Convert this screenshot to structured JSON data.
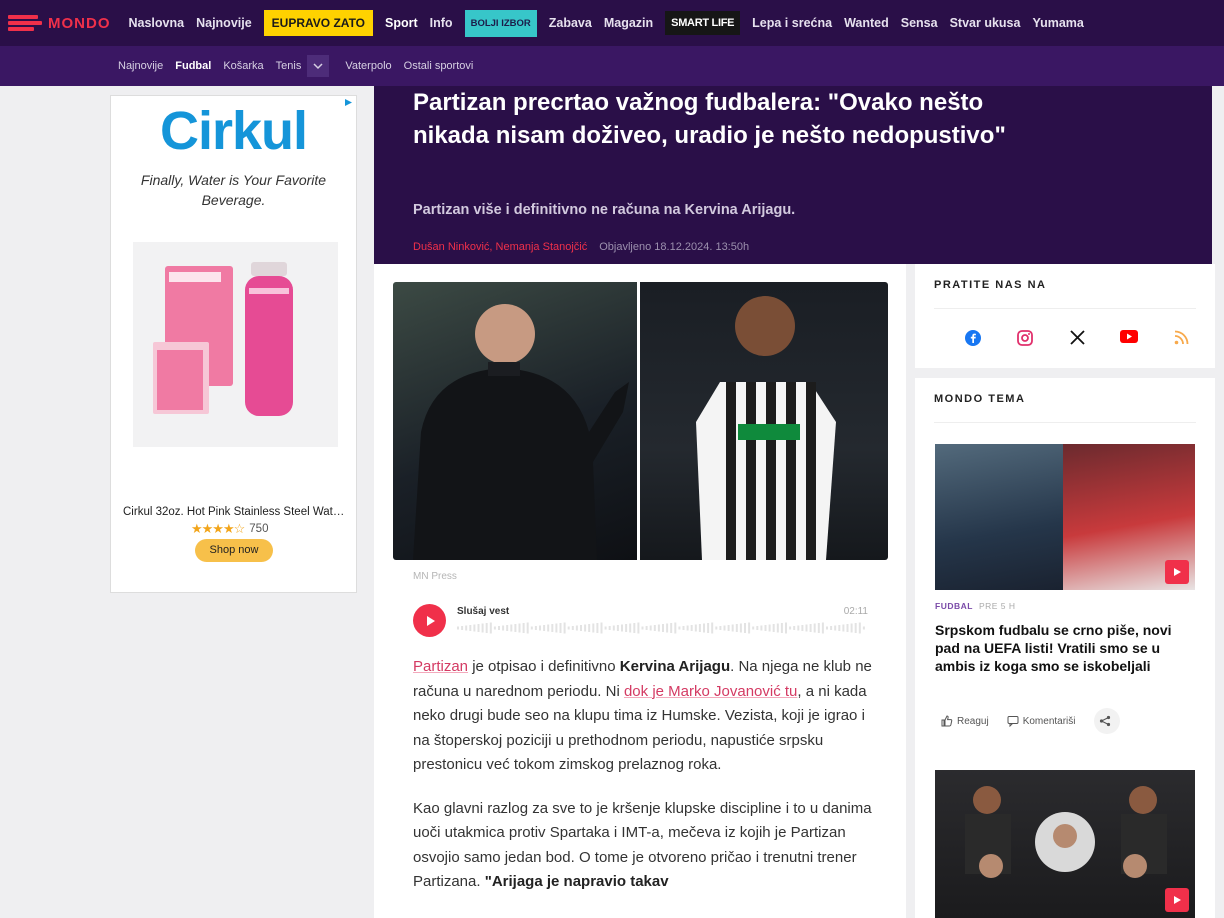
{
  "nav": {
    "logo": "MONDO",
    "items": [
      "Naslovna",
      "Najnovije"
    ],
    "euprav": "EUPRAVO ZATO",
    "items2": [
      "Sport",
      "Info"
    ],
    "bolji": "BOLJI IZBOR",
    "items3": [
      "Zabava",
      "Magazin"
    ],
    "smart": "SMART LIFE",
    "items4": [
      "Lepa i srećna",
      "Wanted",
      "Sensa",
      "Stvar ukusa",
      "Yumama"
    ],
    "active": "Sport"
  },
  "subnav": {
    "items": [
      "Najnovije",
      "Fudbal",
      "Košarka",
      "Tenis"
    ],
    "items2": [
      "Vaterpolo",
      "Ostali sportovi"
    ],
    "active": "Fudbal"
  },
  "ad": {
    "brand": "Cirkul",
    "tagline": "Finally, Water is Your Favorite Beverage.",
    "product": "Cirkul 32oz. Hot Pink Stainless Steel Wat…",
    "rating_count": "750",
    "stars": "★★★★☆",
    "cta": "Shop now",
    "accent": "#1595d9"
  },
  "article": {
    "title": "Partizan precrtao važnog fudbalera: \"Ovako nešto nikada nisam doživeo, uradio je nešto nedopustivo\"",
    "lead": "Partizan više i definitivno ne računa na Kervina Arijagu.",
    "authors": "Dušan Ninković, Nemanja Stanojčić",
    "published": "Objavljeno 18.12.2024. 13:50h",
    "photo_credit": "MN Press",
    "audio_label": "Slušaj vest",
    "audio_time": "02:11",
    "p1": {
      "link1": "Partizan",
      "t1": " je otpisao i definitivno ",
      "bold1": "Kervina Arijagu",
      "t2": ". Na njega ne klub ne računa u narednom periodu. Ni ",
      "link2": "dok je Marko Jovanović tu",
      "t3": ", a ni kada neko drugi bude seo na klupu tima iz Humske. Vezista, koji je igrao i na štoperskoj poziciji u prethodnom periodu, napustiće srpsku prestonicu već tokom zimskog prelaznog roka."
    },
    "p2": {
      "t1": "Kao glavni razlog za sve to je kršenje klupske discipline i to u danima uoči utakmica protiv Spartaka i IMT-a, mečeva iz kojih je Partizan osvojio samo jedan bod. O tome je otvoreno pričao i trenutni trener Partizana. ",
      "bold1": "\"Arijaga je napravio takav"
    }
  },
  "sidebar": {
    "follow_title": "PRATITE NAS NA",
    "social": [
      "facebook-icon",
      "instagram-icon",
      "x-icon",
      "youtube-icon",
      "rss-icon"
    ],
    "tema_title": "MONDO TEMA",
    "tema_tag": "FUDBAL",
    "tema_age": "PRE 5 H",
    "tema_headline": "Srpskom fudbalu se crno piše, novi pad na UEFA listi! Vratili smo se u ambis iz koga smo se iskobeljali",
    "react_label": "Reaguj",
    "comments_label": "Komentariši"
  },
  "colors": {
    "brand_purple": "#2a0f48",
    "accent_red": "#f0304a"
  }
}
